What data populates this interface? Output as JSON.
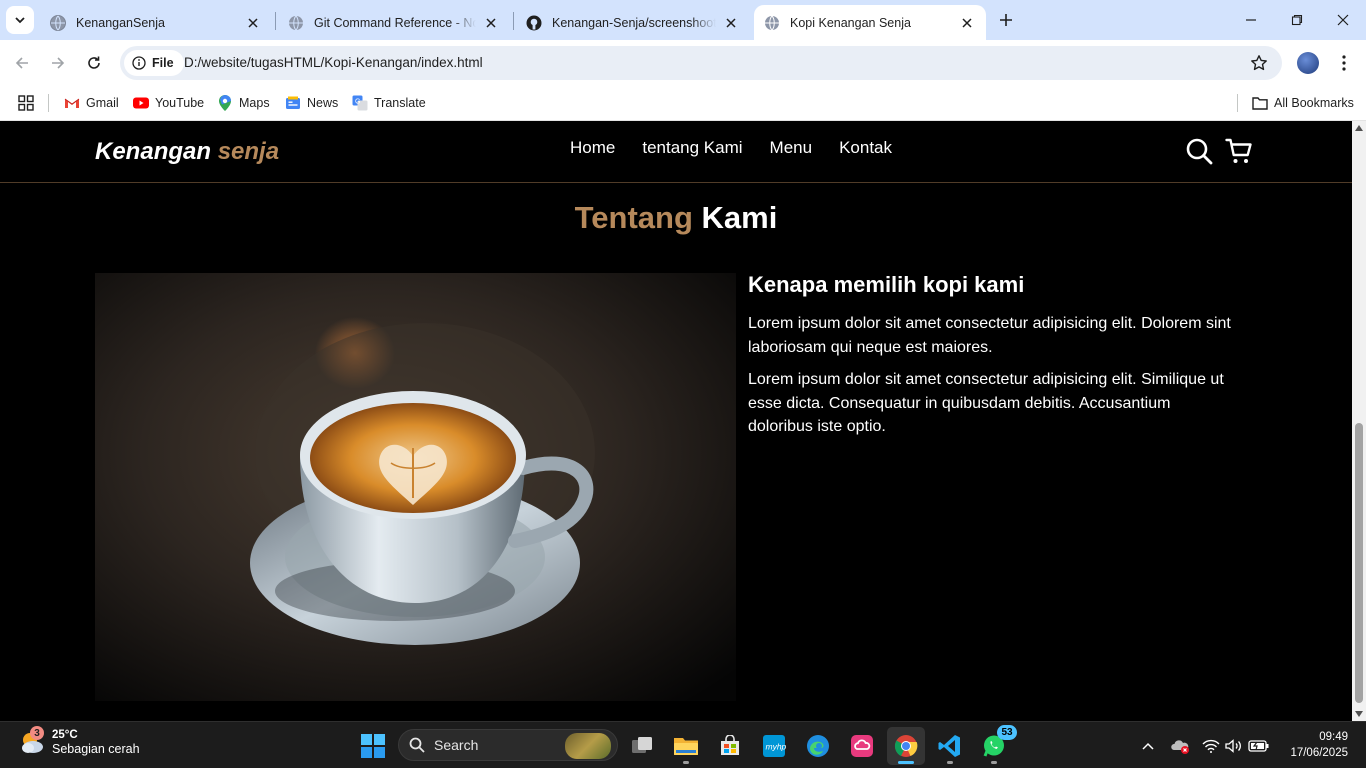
{
  "browser": {
    "tabs": [
      {
        "title": "KenanganSenja",
        "active": false
      },
      {
        "title": "Git Command Reference - Now",
        "active": false
      },
      {
        "title": "Kenangan-Senja/screenshoot/h",
        "active": false
      },
      {
        "title": "Kopi Kenangan Senja",
        "active": true
      }
    ],
    "address": {
      "chip": "File",
      "url": "D:/website/tugasHTML/Kopi-Kenangan/index.html"
    },
    "bookmarks": [
      "Gmail",
      "YouTube",
      "Maps",
      "News",
      "Translate"
    ],
    "all_bookmarks": "All Bookmarks"
  },
  "page": {
    "brand": {
      "main": "Kenangan ",
      "accent": "senja"
    },
    "nav": [
      "Home",
      "tentang Kami",
      "Menu",
      "Kontak"
    ],
    "section_title": {
      "accent": "Tentang",
      "main": " Kami"
    },
    "about": {
      "heading": "Kenapa memilih kopi kami",
      "paragraphs": [
        "Lorem ipsum dolor sit amet consectetur adipisicing elit. Dolorem sint laboriosam qui neque est maiores.",
        "Lorem ipsum dolor sit amet consectetur adipisicing elit. Similique ut esse dicta. Consequatur in quibusdam debitis. Accusantium doloribus iste optio."
      ]
    },
    "colors": {
      "accent": "#b6895b",
      "background": "#000000"
    }
  },
  "taskbar": {
    "weather": {
      "temp": "25°C",
      "condition": "Sebagian cerah",
      "badge": "3"
    },
    "search_placeholder": "Search",
    "whatsapp_badge": "53",
    "clock": {
      "time": "09:49",
      "date": "17/06/2025"
    }
  }
}
